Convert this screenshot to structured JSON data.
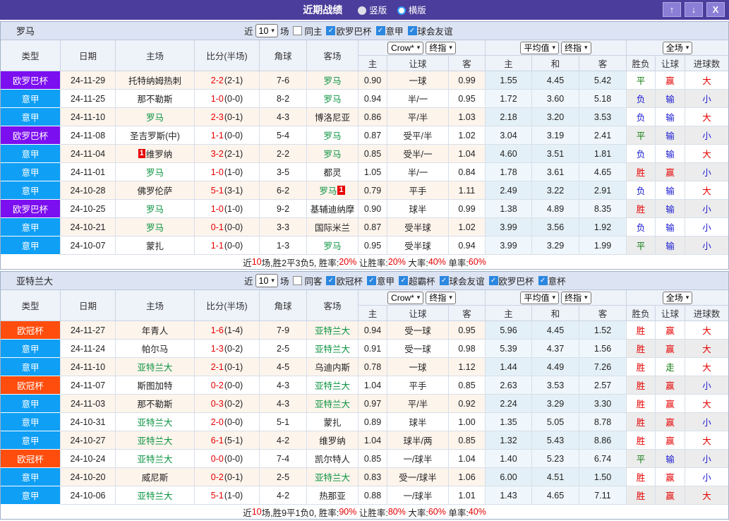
{
  "titlebar": {
    "title": "近期战绩",
    "radios": [
      {
        "label": "竖版",
        "selected": true
      },
      {
        "label": "横版",
        "selected": false
      }
    ],
    "buttons": [
      {
        "name": "up",
        "glyph": "↑"
      },
      {
        "name": "down",
        "glyph": "↓"
      },
      {
        "name": "close",
        "glyph": "X"
      }
    ]
  },
  "table_headers": {
    "main": [
      "类型",
      "日期",
      "主场",
      "比分(半场)",
      "角球",
      "客场"
    ],
    "group_selects": [
      [
        "Crow*",
        "终指"
      ],
      [
        "平均值",
        "终指"
      ],
      [
        "全场"
      ]
    ],
    "sub": [
      "主",
      "让球",
      "客",
      "主",
      "和",
      "客",
      "胜负",
      "让球",
      "进球数"
    ]
  },
  "colors": {
    "type_bg": {
      "欧罗巴杯": "#7c0ff0",
      "意甲": "#0f9ff5",
      "欧冠杯": "#ff4d0d"
    },
    "result": {
      "胜": "#e60000",
      "负": "#1a1ad2",
      "平": "#0a7a0a",
      "赢": "#e60000",
      "输": "#1a1ad2",
      "走": "#0a7a0a",
      "大": "#e60000",
      "小": "#1a1ad2"
    }
  },
  "sections": [
    {
      "team": "罗马",
      "filter": {
        "near_label": "近",
        "count": "10",
        "games_label": "场",
        "same": {
          "label": "同主",
          "checked": false
        },
        "leagues": [
          {
            "label": "欧罗巴杯",
            "checked": true
          },
          {
            "label": "意甲",
            "checked": true
          },
          {
            "label": "球会友谊",
            "checked": true
          }
        ]
      },
      "rows": [
        {
          "type": "欧罗巴杯",
          "date": "24-11-29",
          "home": {
            "name": "托特纳姆热刺",
            "green": false
          },
          "score": "2-2",
          "half": "(2-1)",
          "corner": "7-6",
          "away": {
            "name": "罗马",
            "green": true
          },
          "odds": [
            "0.90",
            "一球",
            "0.99"
          ],
          "avg": [
            "1.55",
            "4.45",
            "5.42"
          ],
          "result": [
            "平",
            "赢",
            "大"
          ]
        },
        {
          "type": "意甲",
          "date": "24-11-25",
          "home": {
            "name": "那不勒斯",
            "green": false
          },
          "score": "1-0",
          "half": "(0-0)",
          "corner": "8-2",
          "away": {
            "name": "罗马",
            "green": true
          },
          "odds": [
            "0.94",
            "半/一",
            "0.95"
          ],
          "avg": [
            "1.72",
            "3.60",
            "5.18"
          ],
          "result": [
            "负",
            "输",
            "小"
          ]
        },
        {
          "type": "意甲",
          "date": "24-11-10",
          "home": {
            "name": "罗马",
            "green": true
          },
          "score": "2-3",
          "half": "(0-1)",
          "corner": "4-3",
          "away": {
            "name": "博洛尼亚",
            "green": false
          },
          "odds": [
            "0.86",
            "平/半",
            "1.03"
          ],
          "avg": [
            "2.18",
            "3.20",
            "3.53"
          ],
          "result": [
            "负",
            "输",
            "大"
          ]
        },
        {
          "type": "欧罗巴杯",
          "date": "24-11-08",
          "home": {
            "name": "圣吉罗斯(中)",
            "green": false
          },
          "score": "1-1",
          "half": "(0-0)",
          "corner": "5-4",
          "away": {
            "name": "罗马",
            "green": true
          },
          "odds": [
            "0.87",
            "受平/半",
            "1.02"
          ],
          "avg": [
            "3.04",
            "3.19",
            "2.41"
          ],
          "result": [
            "平",
            "输",
            "小"
          ]
        },
        {
          "type": "意甲",
          "date": "24-11-04",
          "home": {
            "name": "维罗纳",
            "green": false,
            "badge": "1",
            "badge_pos": "before"
          },
          "score": "3-2",
          "half": "(2-1)",
          "corner": "2-2",
          "away": {
            "name": "罗马",
            "green": true
          },
          "odds": [
            "0.85",
            "受半/一",
            "1.04"
          ],
          "avg": [
            "4.60",
            "3.51",
            "1.81"
          ],
          "result": [
            "负",
            "输",
            "大"
          ]
        },
        {
          "type": "意甲",
          "date": "24-11-01",
          "home": {
            "name": "罗马",
            "green": true
          },
          "score": "1-0",
          "half": "(1-0)",
          "corner": "3-5",
          "away": {
            "name": "都灵",
            "green": false
          },
          "odds": [
            "1.05",
            "半/一",
            "0.84"
          ],
          "avg": [
            "1.78",
            "3.61",
            "4.65"
          ],
          "result": [
            "胜",
            "赢",
            "小"
          ]
        },
        {
          "type": "意甲",
          "date": "24-10-28",
          "home": {
            "name": "佛罗伦萨",
            "green": false
          },
          "score": "5-1",
          "half": "(3-1)",
          "corner": "6-2",
          "away": {
            "name": "罗马",
            "green": true,
            "badge": "1",
            "badge_pos": "after"
          },
          "odds": [
            "0.79",
            "平手",
            "1.11"
          ],
          "avg": [
            "2.49",
            "3.22",
            "2.91"
          ],
          "result": [
            "负",
            "输",
            "大"
          ]
        },
        {
          "type": "欧罗巴杯",
          "date": "24-10-25",
          "home": {
            "name": "罗马",
            "green": true
          },
          "score": "1-0",
          "half": "(1-0)",
          "corner": "9-2",
          "away": {
            "name": "基辅迪纳摩",
            "green": false
          },
          "odds": [
            "0.90",
            "球半",
            "0.99"
          ],
          "avg": [
            "1.38",
            "4.89",
            "8.35"
          ],
          "result": [
            "胜",
            "输",
            "小"
          ]
        },
        {
          "type": "意甲",
          "date": "24-10-21",
          "home": {
            "name": "罗马",
            "green": true
          },
          "score": "0-1",
          "half": "(0-0)",
          "corner": "3-3",
          "away": {
            "name": "国际米兰",
            "green": false
          },
          "odds": [
            "0.87",
            "受半球",
            "1.02"
          ],
          "avg": [
            "3.99",
            "3.56",
            "1.92"
          ],
          "result": [
            "负",
            "输",
            "小"
          ]
        },
        {
          "type": "意甲",
          "date": "24-10-07",
          "home": {
            "name": "蒙扎",
            "green": false
          },
          "score": "1-1",
          "half": "(0-0)",
          "corner": "1-3",
          "away": {
            "name": "罗马",
            "green": true
          },
          "odds": [
            "0.95",
            "受半球",
            "0.94"
          ],
          "avg": [
            "3.99",
            "3.29",
            "1.99"
          ],
          "result": [
            "平",
            "输",
            "小"
          ]
        }
      ],
      "summary": [
        [
          "近",
          "d"
        ],
        [
          "10",
          "r"
        ],
        [
          "场,胜2平3负5, 胜率:",
          "d"
        ],
        [
          "20%",
          "r"
        ],
        [
          " 让胜率:",
          "d"
        ],
        [
          "20%",
          "r"
        ],
        [
          " 大率:",
          "d"
        ],
        [
          "40%",
          "r"
        ],
        [
          " 单率:",
          "d"
        ],
        [
          "60%",
          "r"
        ]
      ]
    },
    {
      "team": "亚特兰大",
      "filter": {
        "near_label": "近",
        "count": "10",
        "games_label": "场",
        "same": {
          "label": "同客",
          "checked": false
        },
        "leagues": [
          {
            "label": "欧冠杯",
            "checked": true
          },
          {
            "label": "意甲",
            "checked": true
          },
          {
            "label": "超霸杯",
            "checked": true
          },
          {
            "label": "球会友谊",
            "checked": true
          },
          {
            "label": "欧罗巴杯",
            "checked": true
          },
          {
            "label": "意杯",
            "checked": true
          }
        ]
      },
      "rows": [
        {
          "type": "欧冠杯",
          "date": "24-11-27",
          "home": {
            "name": "年青人",
            "green": false
          },
          "score": "1-6",
          "half": "(1-4)",
          "corner": "7-9",
          "away": {
            "name": "亚特兰大",
            "green": true
          },
          "odds": [
            "0.94",
            "受一球",
            "0.95"
          ],
          "avg": [
            "5.96",
            "4.45",
            "1.52"
          ],
          "result": [
            "胜",
            "赢",
            "大"
          ]
        },
        {
          "type": "意甲",
          "date": "24-11-24",
          "home": {
            "name": "帕尔马",
            "green": false
          },
          "score": "1-3",
          "half": "(0-2)",
          "corner": "2-5",
          "away": {
            "name": "亚特兰大",
            "green": true
          },
          "odds": [
            "0.91",
            "受一球",
            "0.98"
          ],
          "avg": [
            "5.39",
            "4.37",
            "1.56"
          ],
          "result": [
            "胜",
            "赢",
            "大"
          ]
        },
        {
          "type": "意甲",
          "date": "24-11-10",
          "home": {
            "name": "亚特兰大",
            "green": true
          },
          "score": "2-1",
          "half": "(0-1)",
          "corner": "4-5",
          "away": {
            "name": "乌迪内斯",
            "green": false
          },
          "odds": [
            "0.78",
            "一球",
            "1.12"
          ],
          "avg": [
            "1.44",
            "4.49",
            "7.26"
          ],
          "result": [
            "胜",
            "走",
            "大"
          ]
        },
        {
          "type": "欧冠杯",
          "date": "24-11-07",
          "home": {
            "name": "斯图加特",
            "green": false
          },
          "score": "0-2",
          "half": "(0-0)",
          "corner": "4-3",
          "away": {
            "name": "亚特兰大",
            "green": true
          },
          "odds": [
            "1.04",
            "平手",
            "0.85"
          ],
          "avg": [
            "2.63",
            "3.53",
            "2.57"
          ],
          "result": [
            "胜",
            "赢",
            "小"
          ]
        },
        {
          "type": "意甲",
          "date": "24-11-03",
          "home": {
            "name": "那不勒斯",
            "green": false
          },
          "score": "0-3",
          "half": "(0-2)",
          "corner": "4-3",
          "away": {
            "name": "亚特兰大",
            "green": true
          },
          "odds": [
            "0.97",
            "平/半",
            "0.92"
          ],
          "avg": [
            "2.24",
            "3.29",
            "3.30"
          ],
          "result": [
            "胜",
            "赢",
            "大"
          ]
        },
        {
          "type": "意甲",
          "date": "24-10-31",
          "home": {
            "name": "亚特兰大",
            "green": true
          },
          "score": "2-0",
          "half": "(0-0)",
          "corner": "5-1",
          "away": {
            "name": "蒙扎",
            "green": false
          },
          "odds": [
            "0.89",
            "球半",
            "1.00"
          ],
          "avg": [
            "1.35",
            "5.05",
            "8.78"
          ],
          "result": [
            "胜",
            "赢",
            "小"
          ]
        },
        {
          "type": "意甲",
          "date": "24-10-27",
          "home": {
            "name": "亚特兰大",
            "green": true
          },
          "score": "6-1",
          "half": "(5-1)",
          "corner": "4-2",
          "away": {
            "name": "维罗纳",
            "green": false
          },
          "odds": [
            "1.04",
            "球半/两",
            "0.85"
          ],
          "avg": [
            "1.32",
            "5.43",
            "8.86"
          ],
          "result": [
            "胜",
            "赢",
            "大"
          ]
        },
        {
          "type": "欧冠杯",
          "date": "24-10-24",
          "home": {
            "name": "亚特兰大",
            "green": true
          },
          "score": "0-0",
          "half": "(0-0)",
          "corner": "7-4",
          "away": {
            "name": "凯尔特人",
            "green": false
          },
          "odds": [
            "0.85",
            "一/球半",
            "1.04"
          ],
          "avg": [
            "1.40",
            "5.23",
            "6.74"
          ],
          "result": [
            "平",
            "输",
            "小"
          ]
        },
        {
          "type": "意甲",
          "date": "24-10-20",
          "home": {
            "name": "威尼斯",
            "green": false
          },
          "score": "0-2",
          "half": "(0-1)",
          "corner": "2-5",
          "away": {
            "name": "亚特兰大",
            "green": true
          },
          "odds": [
            "0.83",
            "受一/球半",
            "1.06"
          ],
          "avg": [
            "6.00",
            "4.51",
            "1.50"
          ],
          "result": [
            "胜",
            "赢",
            "小"
          ]
        },
        {
          "type": "意甲",
          "date": "24-10-06",
          "home": {
            "name": "亚特兰大",
            "green": true
          },
          "score": "5-1",
          "half": "(1-0)",
          "corner": "4-2",
          "away": {
            "name": "热那亚",
            "green": false
          },
          "odds": [
            "0.88",
            "一/球半",
            "1.01"
          ],
          "avg": [
            "1.43",
            "4.65",
            "7.11"
          ],
          "result": [
            "胜",
            "赢",
            "大"
          ]
        }
      ],
      "summary": [
        [
          "近",
          "d"
        ],
        [
          "10",
          "r"
        ],
        [
          "场,胜9平1负0, 胜率:",
          "d"
        ],
        [
          "90%",
          "r"
        ],
        [
          " 让胜率:",
          "d"
        ],
        [
          "80%",
          "r"
        ],
        [
          " 大率:",
          "d"
        ],
        [
          "60%",
          "r"
        ],
        [
          " 单率:",
          "d"
        ],
        [
          "40%",
          "r"
        ]
      ]
    }
  ]
}
